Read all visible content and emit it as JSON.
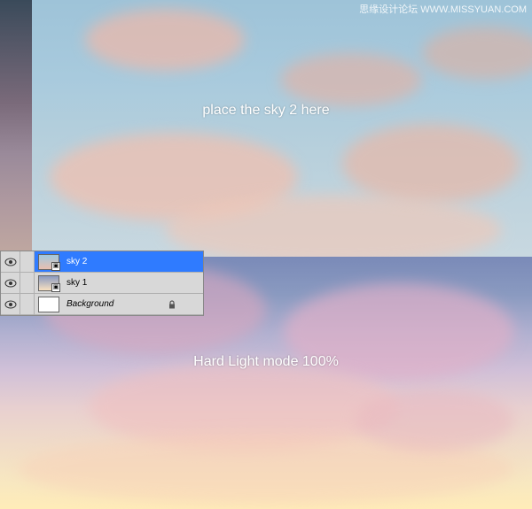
{
  "watermark": "思缘设计论坛  WWW.MISSYUAN.COM",
  "instructions": {
    "top": "place the sky 2 here",
    "bottom": "Hard Light mode 100%"
  },
  "layers": [
    {
      "name": "sky 2",
      "selected": true,
      "locked": false,
      "smart": true,
      "italic": false
    },
    {
      "name": "sky 1",
      "selected": false,
      "locked": false,
      "smart": true,
      "italic": false
    },
    {
      "name": "Background",
      "selected": false,
      "locked": true,
      "smart": false,
      "italic": true
    }
  ],
  "icons": {
    "eye": "eye-icon",
    "lock": "lock-icon",
    "smart": "smart-object-badge"
  }
}
